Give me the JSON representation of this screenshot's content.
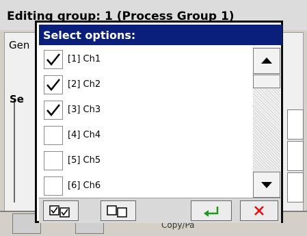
{
  "background": {
    "title": "Editing group: 1 (Process Group 1)",
    "tab_label": "Gen",
    "group_label": "Se",
    "bottom_text": "Copy/Pa"
  },
  "dialog": {
    "title": "Select options:",
    "options": [
      {
        "label": "[1] Ch1",
        "checked": true
      },
      {
        "label": "[2] Ch2",
        "checked": true
      },
      {
        "label": "[3] Ch3",
        "checked": true
      },
      {
        "label": "[4] Ch4",
        "checked": false
      },
      {
        "label": "[5] Ch5",
        "checked": false
      },
      {
        "label": "[6] Ch6",
        "checked": false
      }
    ],
    "footer": {
      "select_all_icon": "select-all-icon",
      "clear_all_icon": "clear-all-icon",
      "ok_icon": "enter-icon",
      "cancel_icon": "close-icon"
    },
    "colors": {
      "title_bg": "#0a1f7a",
      "ok_green": "#1a9a1a",
      "cancel_red": "#e01010"
    }
  }
}
